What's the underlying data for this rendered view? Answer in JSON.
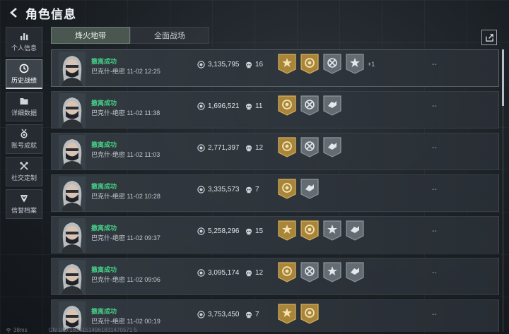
{
  "header": {
    "title": "角色信息"
  },
  "sidebar": {
    "items": [
      {
        "label": "个人信息",
        "icon": "bar-chart-icon"
      },
      {
        "label": "历史战绩",
        "icon": "clock-icon"
      },
      {
        "label": "详细数据",
        "icon": "folder-icon"
      },
      {
        "label": "账号成就",
        "icon": "medal-icon"
      },
      {
        "label": "社交定制",
        "icon": "tools-icon"
      },
      {
        "label": "信誉档案",
        "icon": "shield-icon"
      }
    ]
  },
  "tabs": [
    {
      "label": "烽火地带"
    },
    {
      "label": "全面战场"
    }
  ],
  "records": [
    {
      "status": "撤离成功",
      "detail": "巴克什-绝密 11-02 12:25",
      "money": "3,135,795",
      "kills": "16",
      "badges": [
        "gold-star",
        "gold-ring",
        "grey-cross",
        "grey-star"
      ],
      "extra": "+1",
      "dash": "--"
    },
    {
      "status": "撤离成功",
      "detail": "巴克什-绝密 11-02 11:38",
      "money": "1,696,521",
      "kills": "11",
      "badges": [
        "gold-ring",
        "grey-cross",
        "grey-hand"
      ],
      "extra": "",
      "dash": "--"
    },
    {
      "status": "撤离成功",
      "detail": "巴克什-绝密 11-02 11:03",
      "money": "2,771,397",
      "kills": "12",
      "badges": [
        "gold-ring",
        "grey-cross",
        "grey-hand"
      ],
      "extra": "",
      "dash": "--"
    },
    {
      "status": "撤离成功",
      "detail": "巴克什-绝密 11-02 10:28",
      "money": "3,335,573",
      "kills": "7",
      "badges": [
        "gold-ring",
        "grey-hand"
      ],
      "extra": "",
      "dash": "--"
    },
    {
      "status": "撤离成功",
      "detail": "巴克什-绝密 11-02 09:37",
      "money": "5,258,296",
      "kills": "15",
      "badges": [
        "gold-star",
        "gold-ring",
        "grey-star",
        "grey-hand"
      ],
      "extra": "",
      "dash": "--"
    },
    {
      "status": "撤离成功",
      "detail": "巴克什-绝密 11-02 09:06",
      "money": "3,095,174",
      "kills": "12",
      "badges": [
        "gold-ring",
        "grey-cross",
        "grey-star",
        "grey-hand"
      ],
      "extra": "",
      "dash": "--"
    },
    {
      "status": "撤离成功",
      "detail": "巴克什-绝密 11-02 00:19",
      "money": "3,753,450",
      "kills": "7",
      "badges": [
        "gold-star",
        "gold-ring"
      ],
      "extra": "",
      "dash": "--"
    }
  ],
  "footer": {
    "ping": "38ms",
    "uid": "CN UID:18341514961831470571 5"
  },
  "colors": {
    "success": "#45d088",
    "gold_badge": "#b08a3a",
    "grey_badge": "#6a7279",
    "accent_tab": "#4a5650"
  }
}
